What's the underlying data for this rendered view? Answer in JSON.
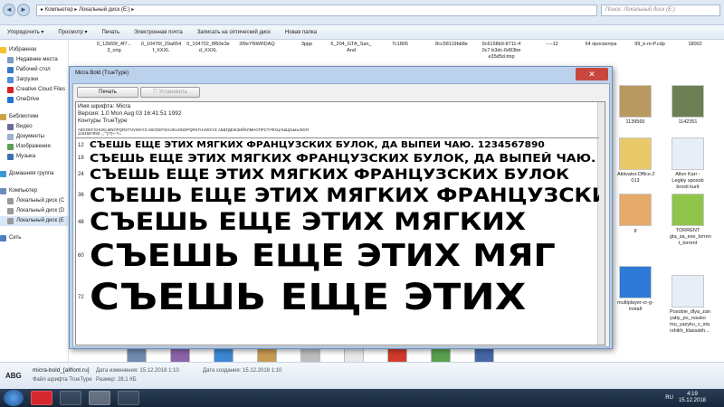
{
  "explorer": {
    "nav_back": "◄",
    "nav_forward": "►",
    "address_path": "▸ Компьютер ▸ Локальный диск (E:) ▸",
    "search_placeholder": "Поиск: Локальный диск (E:)",
    "toolbar": {
      "organize": "Упорядочить ▾",
      "preview": "Просмотр ▾",
      "print": "Печать",
      "email": "Электронная почта",
      "burn": "Записать на оптический диск",
      "new_folder": "Новая папка"
    },
    "sidebar": {
      "favorites": "Избранное",
      "recent": "Недавние места",
      "desktop": "Рабочий стол",
      "downloads": "Загрузки",
      "creative_cloud": "Creative Cloud Files",
      "onedrive": "OneDrive",
      "libraries": "Библиотеки",
      "video": "Видео",
      "documents": "Документы",
      "images": "Изображения",
      "music": "Музыка",
      "homegroup": "Домашняя группа",
      "computer": "Компьютер",
      "disk1": "Локальный диск (C",
      "disk2": "Локальный диск (D",
      "disk3": "Локальный диск (E",
      "network": "Сеть"
    },
    "file_names": [
      "0_12b55f_4f7...\n3_orig",
      "0_10476f_29a654\nf_XXXL",
      "0_104702_8f60e3e\nd_XXXL",
      "3f9eYNWRDAQ",
      "3ppp",
      "6_204_GTA_San_\nAnd",
      "7c1805",
      "8cc58119bb8e",
      "9c6158b9-8711-4\n0c7-b3dc-6d93be\ne35d5d.tmp",
      "----12",
      "64 просмотра",
      "99_k-m-P.cdp",
      "18002"
    ],
    "thumbs": [
      {
        "name": "1139565",
        "color": "#b89a60"
      },
      {
        "name": "1142351",
        "color": "#6d7f54"
      },
      {
        "name": "Aktivator.Office.2\n013",
        "color": "#e9c96a"
      },
      {
        "name": "Allen Karr -\nLegkiy sposob\nbrosit kurit",
        "color": "#e6eef8"
      },
      {
        "name": "g",
        "color": "#e6a96a"
      },
      {
        "name": "TORRENT\ngta_sa_exe_torren\nt_torrent",
        "color": "#8fc54a"
      },
      {
        "name": "multiplayer-cr-g-\ninstall",
        "color": "#2d7bd6"
      },
      {
        "name": "Posobie_dlya_zan\nyatiy_po_russko\nmu_yazyku_v_sta\nrshikh_klassakh...",
        "color": "#e6eef8"
      }
    ]
  },
  "details": {
    "logo": "ABG",
    "file_name": "micra-bold_[allfont.ru]",
    "file_type": "Файл шрифта TrueType",
    "modified": "Дата изменения: 15.12.2018 1:10",
    "size": "Размер: 28,1 КБ",
    "created": "Дата создания: 15.12.2018 1:10"
  },
  "dialog": {
    "title": "Micra Bold (TrueType)",
    "close": "✕",
    "print_button": "Печать",
    "install_button": "Установить",
    "font_name_line": "Имя шрифта: Micra",
    "version_line": "Версия: 1.0 Mon Aug 03 16:41:51 1992",
    "outline_line": "Контуры TrueType",
    "alphabet_upper": "ABCDEFGHIJKLMNOPQRSTUVWXYZ ABCDEFGHIJKLMNOPQRSTUVWXYZ АБВГДЕЖЗИЙКЛМНОПРСТУФХЦЧШЩЪЫЬЭЮЯ",
    "alphabet_lower": "1234567890.:,;'\"(!?)+-*/=",
    "samples": [
      {
        "size": "12",
        "text": "СЪЕШЬ ЕЩЕ ЭТИХ МЯГКИХ ФРАНЦУЗСКИХ БУЛОК, ДА ВЫПЕЙ ЧАЮ. 1234567890"
      },
      {
        "size": "18",
        "text": "СЪЕШЬ ЕЩЕ ЭТИХ МЯГКИХ ФРАНЦУЗСКИХ БУЛОК, ДА ВЫПЕЙ ЧАЮ."
      },
      {
        "size": "24",
        "text": "СЪЕШЬ ЕЩЕ ЭТИХ МЯГКИХ ФРАНЦУЗСКИХ БУЛОК"
      },
      {
        "size": "36",
        "text": "СЪЕШЬ ЕЩЕ ЭТИХ МЯГКИХ ФРАНЦУЗСКИХ"
      },
      {
        "size": "48",
        "text": "СЪЕШЬ ЕЩЕ ЭТИХ МЯГКИХ"
      },
      {
        "size": "60",
        "text": "СЪЕШЬ ЕЩЕ ЭТИХ МЯГ"
      },
      {
        "size": "72",
        "text": "СЪЕШЬ ЕЩЕ ЭТИХ"
      }
    ]
  },
  "taskbar": {
    "lang": "RU",
    "time": "4:19",
    "date": "15.12.2018"
  }
}
